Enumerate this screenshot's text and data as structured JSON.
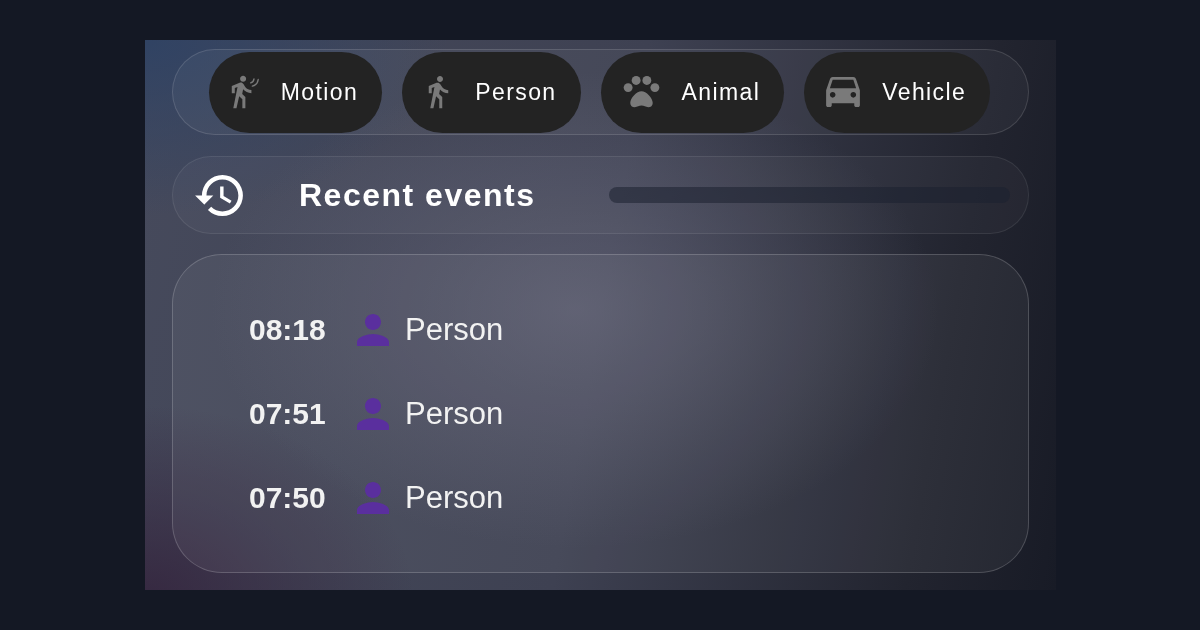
{
  "filters": [
    {
      "label": "Motion",
      "kind": "motion"
    },
    {
      "label": "Person",
      "kind": "person"
    },
    {
      "label": "Animal",
      "kind": "animal"
    },
    {
      "label": "Vehicle",
      "kind": "vehicle"
    }
  ],
  "recent_events": {
    "title": "Recent events",
    "events": [
      {
        "time": "08:18",
        "label": "Person",
        "kind": "person"
      },
      {
        "time": "07:51",
        "label": "Person",
        "kind": "person"
      },
      {
        "time": "07:50",
        "label": "Person",
        "kind": "person"
      }
    ]
  }
}
